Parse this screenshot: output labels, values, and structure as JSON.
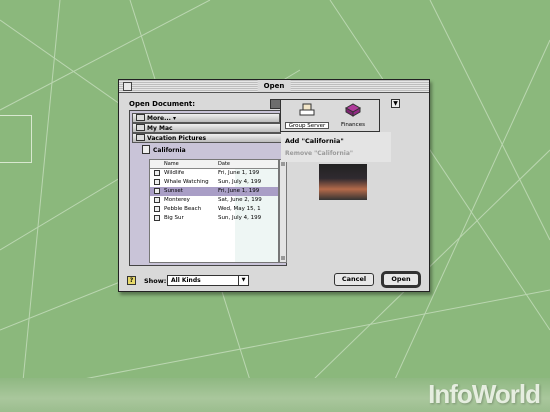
{
  "window": {
    "title": "Open"
  },
  "open_document": {
    "label": "Open Document:"
  },
  "breadcrumbs": [
    "More...",
    "My Mac",
    "Vacation Pictures"
  ],
  "folder": {
    "name": "California"
  },
  "table": {
    "columns": [
      "Name",
      "Date"
    ],
    "rows": [
      {
        "name": "Wildlife",
        "date": "Fri, June 1, 199"
      },
      {
        "name": "Whale Watching",
        "date": "Sun, July 4, 199"
      },
      {
        "name": "Sunset",
        "date": "Fri, June 1, 199"
      },
      {
        "name": "Monterey",
        "date": "Sat, June 2, 199"
      },
      {
        "name": "Pebble Beach",
        "date": "Wed, May 15, 1"
      },
      {
        "name": "Big Sur",
        "date": "Sun, July 4, 199"
      }
    ],
    "selected_index": 2
  },
  "servers": [
    {
      "name": "Group Server",
      "icon": "server-icon"
    },
    {
      "name": "Finances",
      "icon": "folder-icon"
    }
  ],
  "menu": {
    "add": "Add \"California\"",
    "remove": "Remove \"California\""
  },
  "show": {
    "label": "Show:",
    "value": "All Kinds"
  },
  "buttons": {
    "cancel": "Cancel",
    "open": "Open"
  },
  "branding": {
    "watermark": "InfoWorld"
  },
  "colors": {
    "background": "#8bb87c",
    "selection": "#a99ec6",
    "panel": "#c9c4d8"
  }
}
